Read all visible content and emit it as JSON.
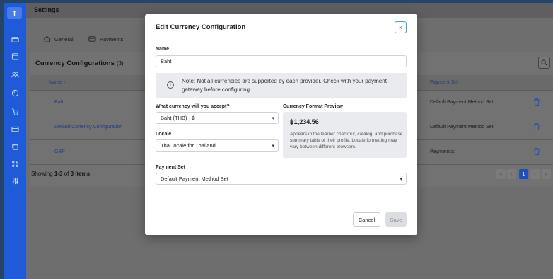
{
  "sidebar": {
    "logo": "T",
    "icons": [
      "wallet-icon",
      "calendar-icon",
      "users-icon",
      "palette-icon",
      "cart-icon",
      "card-icon",
      "copy-icon",
      "network-icon",
      "sliders-icon"
    ]
  },
  "header": {
    "title": "Settings"
  },
  "tabs": [
    {
      "label": "General",
      "icon": "home-icon"
    },
    {
      "label": "Payments",
      "icon": "card-icon"
    }
  ],
  "card": {
    "title": "Currency Configurations",
    "count": "(3)"
  },
  "table": {
    "headers": {
      "name": "Name ↑",
      "payment_set": "Payment Set"
    },
    "rows": [
      {
        "name": "Baht",
        "payment_set": "Default Payment Method Set"
      },
      {
        "name": "Default Currency Configuration",
        "payment_set": "Default Payment Method Set"
      },
      {
        "name": "GBP",
        "payment_set": "Paymetrics"
      }
    ]
  },
  "footer": {
    "prefix": "Showing ",
    "range": "1-3",
    "mid": " of ",
    "total": "3 items"
  },
  "pagination": {
    "first": "«",
    "prev": "‹",
    "current": "1",
    "next": "›",
    "last": "»"
  },
  "modal": {
    "title": "Edit Currency Configuration",
    "close": "×",
    "name_label": "Name",
    "name_value": "Baht",
    "note": "Note: Not all currencies are supported by each provider. Check with your payment gateway before configuring.",
    "currency_label": "What currency will you accept?",
    "currency_value": "Baht (THB) - ฿",
    "preview_label": "Currency Format Preview",
    "preview_amount": "฿1,234.56",
    "preview_desc": "Appears in the learner checkout, catalog, and purchase summary table of their profile. Locale formatting may vary between different browsers.",
    "locale_label": "Locale",
    "locale_value": "Thai locale for Thailand",
    "payment_set_label": "Payment Set",
    "payment_set_value": "Default Payment Method Set",
    "cancel": "Cancel",
    "save": "Save"
  },
  "colors": {
    "accent": "#1f5bd8",
    "link": "#233a85",
    "close_border": "#3aa3d8"
  }
}
